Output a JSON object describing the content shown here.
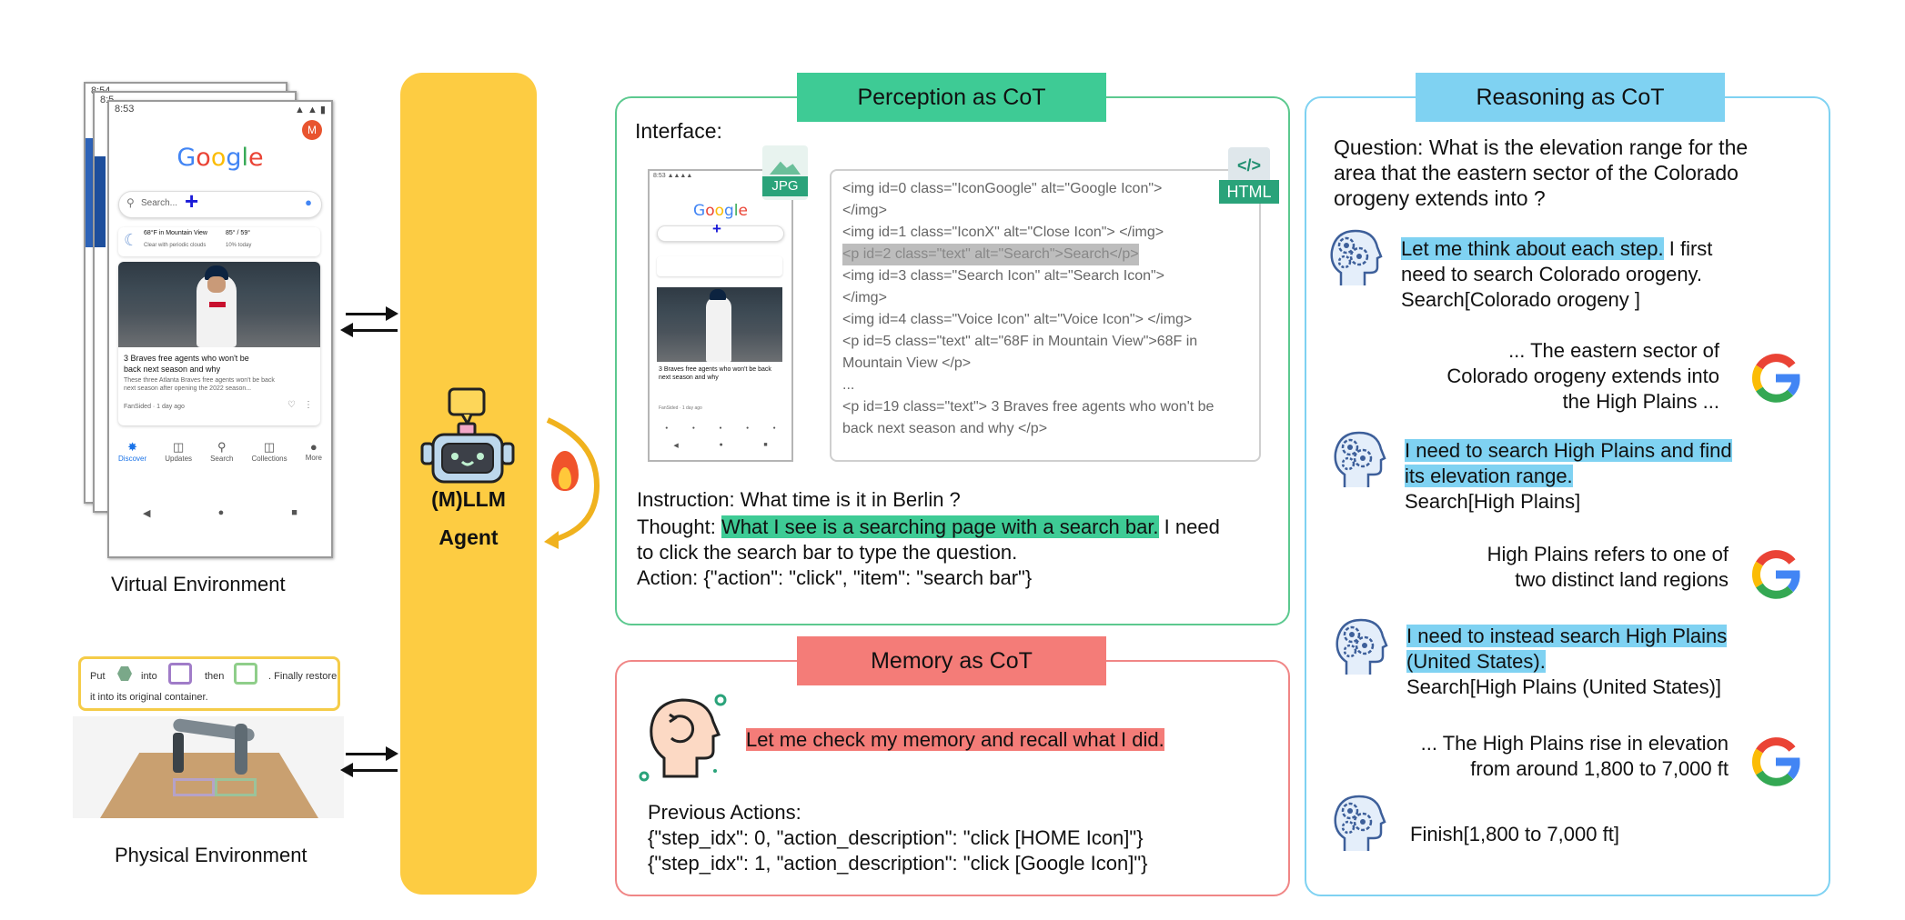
{
  "left": {
    "virtual_label": "Virtual Environment",
    "physical_label": "Physical Environment",
    "phone": {
      "status_time": "8:53",
      "back_time_1": "8:54",
      "back_time_2": "8:5",
      "google_letters": [
        "G",
        "o",
        "o",
        "g",
        "l",
        "e"
      ],
      "google_colors": [
        "#4285F4",
        "#EA4335",
        "#FBBC05",
        "#4285F4",
        "#34A853",
        "#EA4335"
      ],
      "search_placeholder": "Search...",
      "avatar_letter": "M",
      "weather_location": "68°F in Mountain View",
      "weather_range": "85° / 59°",
      "weather_desc": "Clear with periodic clouds",
      "weather_rain": "10% today",
      "news_title": "3 Braves free agents who won't be back next season and why",
      "news_snippet": "These three Atlanta Braves free agents won't be back next season after opening the 2022 season...",
      "news_source": "FanSided · 1 day ago",
      "nav": [
        "Discover",
        "Updates",
        "Search",
        "Collections",
        "More"
      ]
    },
    "robot_task": {
      "put": "Put",
      "into": "into",
      "then": "then",
      "finally": ". Finally restore",
      "line2": "it into its original container."
    }
  },
  "agent": {
    "line1": "(M)LLM",
    "line2": "Agent",
    "fire_icon": "fire-icon"
  },
  "perception": {
    "title": "Perception as CoT",
    "interface_label": "Interface:",
    "jpg_badge": "JPG",
    "html_badge": "HTML",
    "html_code_icon": "</>",
    "code_lines": [
      [
        "<img id=0 class=\"IconGoogle\" alt=\"Google Icon\">",
        "</img>"
      ],
      [
        "<img id=1 class=\"IconX\" alt=\"Close Icon\"> </img>"
      ],
      [
        "<p id=2 class=\"text\" alt=\"Search\">Search</p>"
      ],
      [
        "<img id=3 class=\"Search Icon\" alt=\"Search Icon\">",
        "</img>"
      ],
      [
        "<img id=4 class=\"Voice Icon\" alt=\"Voice Icon\"> </img>"
      ],
      [
        "<p id=5 class=\"text\" alt=\"68F in Mountain View\">68F in",
        "Mountain View </p>"
      ],
      [
        "..."
      ],
      [
        "<p id=19 class=\"text\"> 3 Braves free agents who won't be",
        "back next season and why </p>"
      ]
    ],
    "instruction": "Instruction: What time is it in Berlin ?",
    "thought_prefix": "Thought: ",
    "thought_highlight": "What I see is a searching page with a search bar.",
    "thought_rest1": " I need",
    "thought_rest2": "to click the search bar to type the question.",
    "action": "Action: {\"action\": \"click\", \"item\": \"search bar\"}",
    "highlight_color": "#3ecb95",
    "border_color": "#5cc98f"
  },
  "memory": {
    "title": "Memory as CoT",
    "recall": "Let me check my memory and recall what I did.",
    "prev_label": "Previous Actions:",
    "actions": [
      "{\"step_idx\": 0, \"action_description\": \"click [HOME Icon]\"}",
      "{\"step_idx\": 1, \"action_description\": \"click [Google Icon]\"}"
    ],
    "highlight_color": "#f47c78",
    "border_color": "#f08686"
  },
  "reasoning": {
    "title": "Reasoning as CoT",
    "question": [
      "Question: What is the elevation range for the",
      "area that the eastern sector of the Colorado",
      "orogeny extends into ?"
    ],
    "step1_hl": "Let me think about each step.",
    "step1_rest": " I first",
    "step1_l2": "need to search Colorado orogeny.",
    "step1_l3": "Search[Colorado orogeny ]",
    "obs1": [
      "... The eastern sector of",
      "Colorado orogeny extends into",
      "the High Plains ..."
    ],
    "step2_hl": [
      "I need to search High Plains and find",
      "its elevation range."
    ],
    "step2_l3": "Search[High Plains]",
    "obs2": [
      "High Plains refers to one of",
      "two distinct land regions"
    ],
    "step3_hl": [
      "I need to instead search High Plains",
      "(United States)."
    ],
    "step3_l3": "Search[High Plains (United States)]",
    "obs3": [
      "... The High Plains rise in elevation",
      "from around 1,800 to 7,000 ft"
    ],
    "finish": "Finish[1,800 to 7,000 ft]",
    "highlight_color": "#7fd2f2",
    "border_color": "#7fd2f2",
    "google_icon": "google-icon",
    "head_icon": "brain-gears-icon"
  }
}
